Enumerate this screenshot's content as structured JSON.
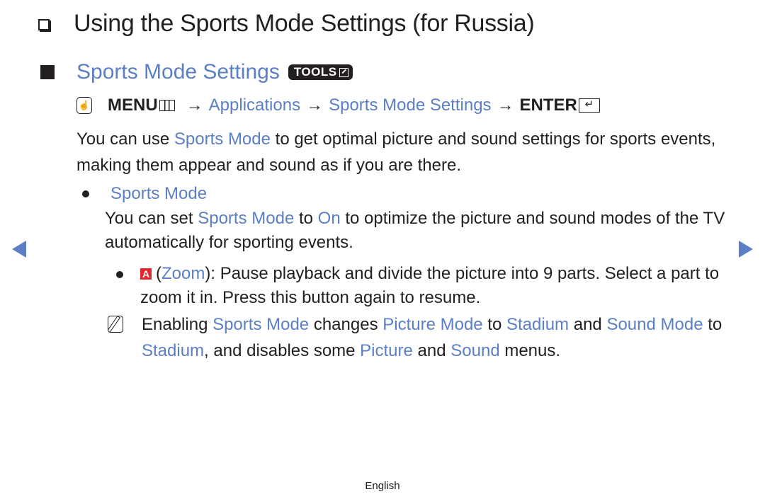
{
  "colors": {
    "accent_blue": "#5b7fc4",
    "text": "#231f20",
    "red_button": "#e3262d"
  },
  "title": "Using the Sports Mode Settings (for Russia)",
  "section": {
    "title": "Sports Mode Settings",
    "tools_badge": "TOOLS",
    "tools_icon": "tools-arrow-icon"
  },
  "menu_path": {
    "hand_icon": "remote-hand-icon",
    "menu": "MENU",
    "arrow": "→",
    "items": [
      "Applications",
      "Sports Mode Settings"
    ],
    "enter": "ENTER",
    "enter_glyph": "↵"
  },
  "intro": {
    "part1": "You can use ",
    "link1": "Sports Mode",
    "part2": " to get optimal picture and sound settings for sports events, making them appear and sound as if you are there."
  },
  "bullet_sports": {
    "label": "Sports Mode",
    "desc_part1": "You can set ",
    "desc_link1": "Sports Mode",
    "desc_part2": " to ",
    "desc_link2": "On",
    "desc_part3": " to optimize the picture and sound modes of the TV automatically for sporting events."
  },
  "zoom_bullet": {
    "button_letter": "A",
    "open_paren": "(",
    "label": "Zoom",
    "text": "): Pause playback and divide the picture into 9 parts. Select a part to zoom it in. Press this button again to resume."
  },
  "note": {
    "icon": "note-pencil-icon",
    "t1": "Enabling ",
    "l1": "Sports Mode",
    "t2": " changes ",
    "l2": "Picture Mode",
    "t3": " to ",
    "l3": "Stadium",
    "t4": " and ",
    "l4": "Sound Mode",
    "t5": " to ",
    "l5": "Stadium",
    "t6": ", and disables some ",
    "l6": "Picture",
    "t7": " and ",
    "l7": "Sound",
    "t8": " menus."
  },
  "nav": {
    "prev": "previous-page",
    "next": "next-page"
  },
  "footer": {
    "language": "English"
  }
}
